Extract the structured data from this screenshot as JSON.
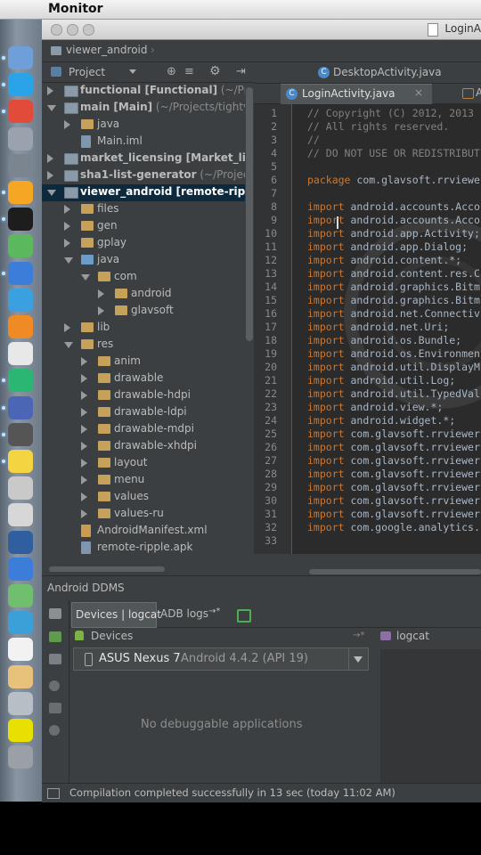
{
  "menubar": {
    "apple_glyph": "",
    "app_name": "Monitor"
  },
  "window": {
    "title": "LoginA",
    "breadcrumb": "viewer_android",
    "project_panel": {
      "dropdown_label": "Project",
      "tree": [
        {
          "label": "functional",
          "bold_suffix": " [Functional]",
          "path": " (~/Proje",
          "level": 0,
          "expanded": false,
          "icon": "module"
        },
        {
          "label": "main",
          "bold_suffix": " [Main]",
          "path": " (~/Projects/tightvnc",
          "level": 0,
          "expanded": true,
          "icon": "module"
        },
        {
          "label": "java",
          "bold_suffix": "",
          "path": "",
          "level": 1,
          "expanded": false,
          "icon": "folder"
        },
        {
          "label": "Main.iml",
          "bold_suffix": "",
          "path": "",
          "level": 1,
          "expanded": null,
          "icon": "file"
        },
        {
          "label": "market_licensing",
          "bold_suffix": " [Market_licens",
          "path": "",
          "level": 0,
          "expanded": false,
          "icon": "module"
        },
        {
          "label": "sha1-list-generator",
          "bold_suffix": "",
          "path": " (~/Projec",
          "level": 0,
          "expanded": false,
          "icon": "module"
        },
        {
          "label": "viewer_android",
          "bold_suffix": " [remote-ripple",
          "path": "",
          "level": 0,
          "expanded": true,
          "icon": "module",
          "selected": true
        },
        {
          "label": "files",
          "bold_suffix": "",
          "path": "",
          "level": 1,
          "expanded": false,
          "icon": "folder"
        },
        {
          "label": "gen",
          "bold_suffix": "",
          "path": "",
          "level": 1,
          "expanded": false,
          "icon": "folder"
        },
        {
          "label": "gplay",
          "bold_suffix": "",
          "path": "",
          "level": 1,
          "expanded": false,
          "icon": "folder"
        },
        {
          "label": "java",
          "bold_suffix": "",
          "path": "",
          "level": 1,
          "expanded": true,
          "icon": "src"
        },
        {
          "label": "com",
          "bold_suffix": "",
          "path": "",
          "level": 2,
          "expanded": true,
          "icon": "folder"
        },
        {
          "label": "android",
          "bold_suffix": "",
          "path": "",
          "level": 3,
          "expanded": false,
          "icon": "folder"
        },
        {
          "label": "glavsoft",
          "bold_suffix": "",
          "path": "",
          "level": 3,
          "expanded": false,
          "icon": "folder"
        },
        {
          "label": "lib",
          "bold_suffix": "",
          "path": "",
          "level": 1,
          "expanded": false,
          "icon": "folder"
        },
        {
          "label": "res",
          "bold_suffix": "",
          "path": "",
          "level": 1,
          "expanded": true,
          "icon": "folder"
        },
        {
          "label": "anim",
          "bold_suffix": "",
          "path": "",
          "level": 2,
          "expanded": false,
          "icon": "folder"
        },
        {
          "label": "drawable",
          "bold_suffix": "",
          "path": "",
          "level": 2,
          "expanded": false,
          "icon": "folder"
        },
        {
          "label": "drawable-hdpi",
          "bold_suffix": "",
          "path": "",
          "level": 2,
          "expanded": false,
          "icon": "folder"
        },
        {
          "label": "drawable-ldpi",
          "bold_suffix": "",
          "path": "",
          "level": 2,
          "expanded": false,
          "icon": "folder"
        },
        {
          "label": "drawable-mdpi",
          "bold_suffix": "",
          "path": "",
          "level": 2,
          "expanded": false,
          "icon": "folder"
        },
        {
          "label": "drawable-xhdpi",
          "bold_suffix": "",
          "path": "",
          "level": 2,
          "expanded": false,
          "icon": "folder"
        },
        {
          "label": "layout",
          "bold_suffix": "",
          "path": "",
          "level": 2,
          "expanded": false,
          "icon": "folder"
        },
        {
          "label": "menu",
          "bold_suffix": "",
          "path": "",
          "level": 2,
          "expanded": false,
          "icon": "folder"
        },
        {
          "label": "values",
          "bold_suffix": "",
          "path": "",
          "level": 2,
          "expanded": false,
          "icon": "folder"
        },
        {
          "label": "values-ru",
          "bold_suffix": "",
          "path": "",
          "level": 2,
          "expanded": false,
          "icon": "folder"
        },
        {
          "label": "AndroidManifest.xml",
          "bold_suffix": "",
          "path": "",
          "level": 1,
          "expanded": null,
          "icon": "xml"
        },
        {
          "label": "remote-ripple.apk",
          "bold_suffix": "",
          "path": "",
          "level": 1,
          "expanded": null,
          "icon": "file"
        }
      ]
    },
    "editor": {
      "tab_top": "DesktopActivity.java",
      "tab_active": "LoginActivity.java",
      "tab_right": "A",
      "lines": [
        {
          "n": "1",
          "parts": [
            [
              "cm",
              "// Copyright (C) 2012, 2013"
            ]
          ]
        },
        {
          "n": "2",
          "parts": [
            [
              "cm",
              "// All rights reserved."
            ]
          ]
        },
        {
          "n": "3",
          "parts": [
            [
              "cm",
              "//"
            ]
          ]
        },
        {
          "n": "4",
          "parts": [
            [
              "cm",
              "// DO NOT USE OR REDISTRIBUT"
            ]
          ]
        },
        {
          "n": "5",
          "parts": [
            [
              "",
              ""
            ]
          ]
        },
        {
          "n": "6",
          "parts": [
            [
              "kw",
              "package "
            ],
            [
              "",
              "com.glavsoft.rrviewe"
            ]
          ]
        },
        {
          "n": "7",
          "parts": [
            [
              "",
              ""
            ]
          ]
        },
        {
          "n": "8",
          "parts": [
            [
              "kw",
              "import "
            ],
            [
              "",
              "android.accounts.Acco"
            ]
          ]
        },
        {
          "n": "9",
          "parts": [
            [
              "kw",
              "import "
            ],
            [
              "",
              "android.accounts.Acco"
            ]
          ]
        },
        {
          "n": "10",
          "parts": [
            [
              "kw",
              "import "
            ],
            [
              "",
              "android.app.Activity;"
            ]
          ]
        },
        {
          "n": "11",
          "parts": [
            [
              "kw",
              "import "
            ],
            [
              "",
              "android.app.Dialog;"
            ]
          ]
        },
        {
          "n": "12",
          "parts": [
            [
              "kw",
              "import "
            ],
            [
              "",
              "android.content.*;"
            ]
          ]
        },
        {
          "n": "13",
          "parts": [
            [
              "kw",
              "import "
            ],
            [
              "",
              "android.content.res.C"
            ]
          ]
        },
        {
          "n": "14",
          "parts": [
            [
              "kw",
              "import "
            ],
            [
              "",
              "android.graphics.Bitm"
            ]
          ]
        },
        {
          "n": "15",
          "parts": [
            [
              "kw",
              "import "
            ],
            [
              "",
              "android.graphics.Bitm"
            ]
          ]
        },
        {
          "n": "16",
          "parts": [
            [
              "kw",
              "import "
            ],
            [
              "",
              "android.net.Connectiv"
            ]
          ]
        },
        {
          "n": "17",
          "parts": [
            [
              "kw",
              "import "
            ],
            [
              "",
              "android.net.Uri;"
            ]
          ]
        },
        {
          "n": "18",
          "parts": [
            [
              "kw",
              "import "
            ],
            [
              "",
              "android.os.Bundle;"
            ]
          ]
        },
        {
          "n": "19",
          "parts": [
            [
              "kw",
              "import "
            ],
            [
              "",
              "android.os.Environmen"
            ]
          ]
        },
        {
          "n": "20",
          "parts": [
            [
              "kw",
              "import "
            ],
            [
              "",
              "android.util.DisplayM"
            ]
          ]
        },
        {
          "n": "21",
          "parts": [
            [
              "kw",
              "import "
            ],
            [
              "",
              "android.util.Log;"
            ]
          ]
        },
        {
          "n": "22",
          "parts": [
            [
              "kw",
              "import "
            ],
            [
              "",
              "android.util.TypedVal"
            ]
          ]
        },
        {
          "n": "23",
          "parts": [
            [
              "kw",
              "import "
            ],
            [
              "",
              "android.view.*;"
            ]
          ]
        },
        {
          "n": "24",
          "parts": [
            [
              "kw",
              "import "
            ],
            [
              "",
              "android.widget.*;"
            ]
          ]
        },
        {
          "n": "25",
          "parts": [
            [
              "kw",
              "import "
            ],
            [
              "",
              "com.glavsoft.rrviewer"
            ]
          ]
        },
        {
          "n": "26",
          "parts": [
            [
              "kw",
              "import "
            ],
            [
              "",
              "com.glavsoft.rrviewer"
            ]
          ]
        },
        {
          "n": "27",
          "parts": [
            [
              "kw",
              "import "
            ],
            [
              "",
              "com.glavsoft.rrviewer"
            ]
          ]
        },
        {
          "n": "28",
          "parts": [
            [
              "kw",
              "import "
            ],
            [
              "",
              "com.glavsoft.rrviewer"
            ]
          ]
        },
        {
          "n": "29",
          "parts": [
            [
              "kw",
              "import "
            ],
            [
              "",
              "com.glavsoft.rrviewer"
            ]
          ]
        },
        {
          "n": "30",
          "parts": [
            [
              "kw",
              "import "
            ],
            [
              "",
              "com.glavsoft.rrviewer"
            ]
          ]
        },
        {
          "n": "31",
          "parts": [
            [
              "kw",
              "import "
            ],
            [
              "",
              "com.glavsoft.rrviewer"
            ]
          ]
        },
        {
          "n": "32",
          "parts": [
            [
              "kw",
              "import "
            ],
            [
              "",
              "com.google.analytics."
            ]
          ]
        },
        {
          "n": "33",
          "parts": [
            [
              "",
              ""
            ]
          ]
        }
      ]
    },
    "ddms": {
      "header": "Android DDMS",
      "tab_devices": "Devices | logcat",
      "tab_adb": "ADB logs",
      "tab_adb_arrow": "→*",
      "devices_label": "Devices",
      "devices_pin": "→*",
      "device_name": "ASUS Nexus 7",
      "device_detail": " Android 4.4.2 (API 19)",
      "no_apps": "No debuggable applications",
      "logcat_label": "logcat"
    },
    "status": "Compilation completed successfully in 13 sec (today 11:02 AM)"
  },
  "dock_icons": [
    "finder-icon",
    "skype-icon",
    "chrome-icon",
    "launchpad-icon",
    "system-prefs-icon",
    "audio-icon",
    "terminal-icon",
    "adium-icon",
    "qsearch-icon",
    "itunes-icon",
    "ibooks-icon",
    "calendar-icon",
    "sourcetree-icon",
    "intellij-icon",
    "sublime-icon",
    "cyberduck-icon",
    "preview-icon",
    "calculator-icon",
    "instruments-icon",
    "xcode-icon",
    "image-capture-icon",
    "fish-icon",
    "textedit-icon",
    "pencil-icon",
    "stack-icon",
    "divx-icon",
    "trash-icon"
  ]
}
